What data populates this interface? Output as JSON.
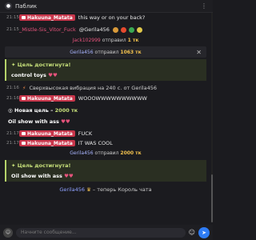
{
  "header": {
    "title": "Паблик",
    "icon": "chat-bubble-icon",
    "more": "⋮"
  },
  "messages": {
    "m1": {
      "time": "21:15",
      "user": "Hakuuna_Matata",
      "text": "this way or on your back?"
    },
    "m2": {
      "time": "21:15",
      "user": "_Mistle-Sis_Vitor_Fuck",
      "mention": "@Gerila456"
    },
    "m3": {
      "user": "Jack102999",
      "text": "отправил",
      "amount": "1 тк"
    },
    "tip1": {
      "user": "Gerila456",
      "text": "отправил",
      "amount": "1063 тк"
    },
    "goal1": {
      "label": "Цель достигнута!",
      "text": "control toys"
    },
    "vib": {
      "time": "21:16",
      "text": "Сверхвысокая вибрация на 240 с. от Gerila456"
    },
    "m4": {
      "time": "21:16",
      "user": "Hakuuna_Matata",
      "text": "WOOOWWWWWWWWWW"
    },
    "newgoal": {
      "label": "Новая цель –",
      "amount": "2000 тк",
      "text": "Oil show with ass"
    },
    "m5": {
      "time": "21:17",
      "user": "Hakuuna_Matata",
      "text": "FUCK"
    },
    "m6": {
      "time": "21:17",
      "user": "Hakuuna_Matata",
      "text": "IT WAS COOL"
    },
    "tip2": {
      "user": "Gerila456",
      "text": "отправил",
      "amount": "2000 тк"
    },
    "goal2": {
      "label": "Цель достигнута!",
      "text": "Oil show with ass"
    },
    "king": {
      "user": "Gerila456",
      "text": "– теперь Король чата"
    }
  },
  "composer": {
    "placeholder": "Начните сообщение..."
  },
  "colors": {
    "accent": "#c8364b",
    "goal": "#b6d36a",
    "send": "#2e7cf6"
  }
}
